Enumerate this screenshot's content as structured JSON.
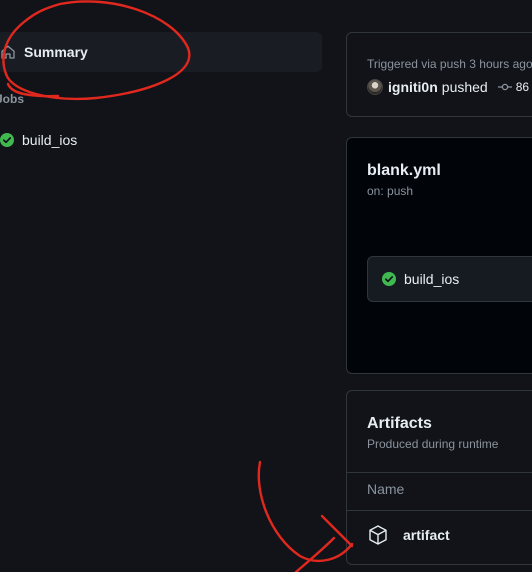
{
  "sidebar": {
    "summary_label": "Summary",
    "jobs_heading": "Jobs",
    "jobs": [
      {
        "label": "build_ios",
        "status": "success"
      }
    ]
  },
  "run": {
    "trigger_text": "Triggered via push 3 hours ago",
    "pusher": "igniti0n",
    "action": "pushed",
    "commit_sha": "86"
  },
  "workflow": {
    "file": "blank.yml",
    "trigger": "on: push",
    "job_label": "build_ios"
  },
  "artifacts": {
    "title": "Artifacts",
    "subtitle": "Produced during runtime",
    "column_name": "Name",
    "items": [
      {
        "name": "artifact"
      }
    ]
  },
  "colors": {
    "background": "#111318",
    "success": "#3fb950",
    "annotation": "#e0281e",
    "border": "#30363d"
  },
  "icons": {
    "summary": "home-icon",
    "job_status": "check-circle-icon",
    "commit": "git-commit-icon",
    "artifact": "package-icon"
  }
}
